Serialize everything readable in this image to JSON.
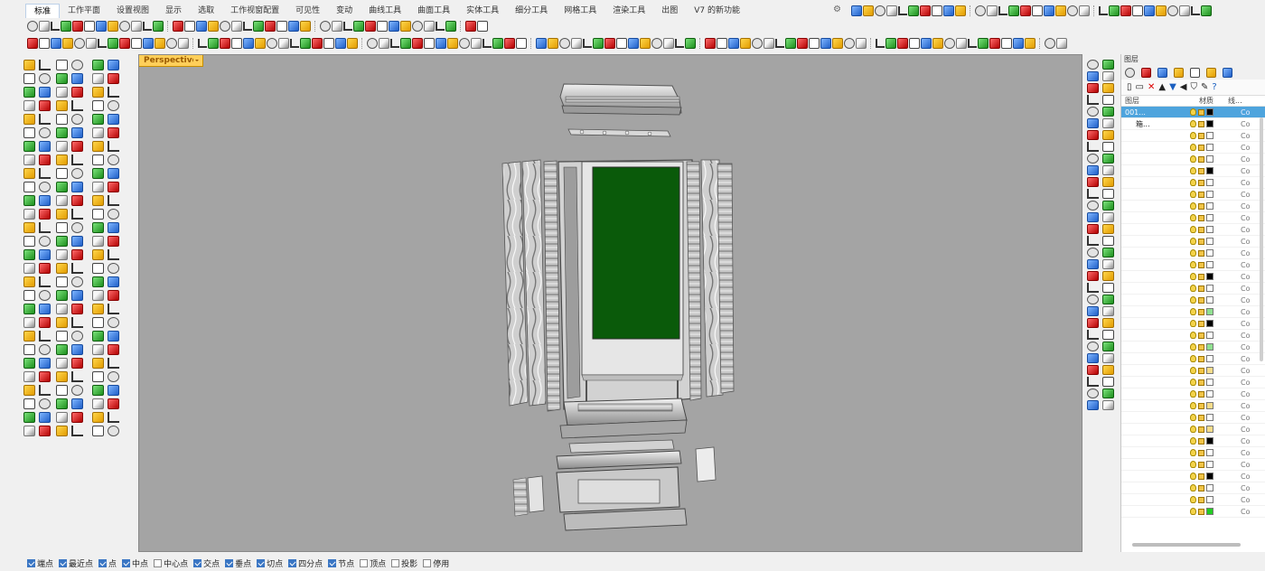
{
  "tabs": [
    "标准",
    "工作平面",
    "设置视图",
    "显示",
    "选取",
    "工作视窗配置",
    "可见性",
    "变动",
    "曲线工具",
    "曲面工具",
    "实体工具",
    "细分工具",
    "网格工具",
    "渲染工具",
    "出图",
    "V7 的新功能"
  ],
  "active_tab_index": 0,
  "viewport": {
    "title": "Perspective",
    "background": "#a4a4a4",
    "screen_color": "#0a5a0a"
  },
  "layers_panel": {
    "title": "图层",
    "headers": {
      "name": "图层",
      "material": "材质",
      "linetype": "线..."
    },
    "rows": [
      {
        "name": "001...",
        "color": "#000000",
        "line": "Co",
        "selected": true
      },
      {
        "name": "箱...",
        "color": "#000000",
        "line": "Co"
      },
      {
        "name": "",
        "color": "#ffffff",
        "line": "Co"
      },
      {
        "name": "",
        "color": "#ffffff",
        "line": "Co"
      },
      {
        "name": "",
        "color": "#ffffff",
        "line": "Co"
      },
      {
        "name": "",
        "color": "#000000",
        "line": "Co"
      },
      {
        "name": "",
        "color": "#ffffff",
        "line": "Co"
      },
      {
        "name": "",
        "color": "#ffffff",
        "line": "Co"
      },
      {
        "name": "",
        "color": "#ffffff",
        "line": "Co"
      },
      {
        "name": "",
        "color": "#ffffff",
        "line": "Co"
      },
      {
        "name": "",
        "color": "#ffffff",
        "line": "Co"
      },
      {
        "name": "",
        "color": "#ffffff",
        "line": "Co"
      },
      {
        "name": "",
        "color": "#ffffff",
        "line": "Co"
      },
      {
        "name": "",
        "color": "#ffffff",
        "line": "Co"
      },
      {
        "name": "",
        "color": "#000000",
        "line": "Co"
      },
      {
        "name": "",
        "color": "#ffffff",
        "line": "Co"
      },
      {
        "name": "",
        "color": "#ffffff",
        "line": "Co"
      },
      {
        "name": "",
        "color": "#90e090",
        "line": "Co"
      },
      {
        "name": "",
        "color": "#000000",
        "line": "Co"
      },
      {
        "name": "",
        "color": "#ffffff",
        "line": "Co"
      },
      {
        "name": "",
        "color": "#90e090",
        "line": "Co"
      },
      {
        "name": "",
        "color": "#ffffff",
        "line": "Co"
      },
      {
        "name": "",
        "color": "#f5dc8a",
        "line": "Co"
      },
      {
        "name": "",
        "color": "#ffffff",
        "line": "Co"
      },
      {
        "name": "",
        "color": "#ffffff",
        "line": "Co"
      },
      {
        "name": "",
        "color": "#f5dc8a",
        "line": "Co"
      },
      {
        "name": "",
        "color": "#ffffff",
        "line": "Co"
      },
      {
        "name": "",
        "color": "#f5dc8a",
        "line": "Co"
      },
      {
        "name": "",
        "color": "#000000",
        "line": "Co"
      },
      {
        "name": "",
        "color": "#ffffff",
        "line": "Co"
      },
      {
        "name": "",
        "color": "#ffffff",
        "line": "Co"
      },
      {
        "name": "",
        "color": "#000000",
        "line": "Co"
      },
      {
        "name": "",
        "color": "#ffffff",
        "line": "Co"
      },
      {
        "name": "",
        "color": "#ffffff",
        "line": "Co"
      },
      {
        "name": "",
        "color": "#22cc22",
        "line": "Co"
      }
    ]
  },
  "status_snaps": [
    {
      "label": "端点",
      "checked": true
    },
    {
      "label": "最近点",
      "checked": true
    },
    {
      "label": "点",
      "checked": true
    },
    {
      "label": "中点",
      "checked": true
    },
    {
      "label": "中心点",
      "checked": false
    },
    {
      "label": "交点",
      "checked": true
    },
    {
      "label": "垂点",
      "checked": true
    },
    {
      "label": "切点",
      "checked": true
    },
    {
      "label": "四分点",
      "checked": true
    },
    {
      "label": "节点",
      "checked": true
    },
    {
      "label": "顶点",
      "checked": false
    },
    {
      "label": "投影",
      "checked": false
    },
    {
      "label": "停用",
      "checked": false
    }
  ],
  "colors": {
    "accent": "#4ea4dd",
    "viewport_label": "#ffcf5a",
    "checkbox": "#3a76c4"
  }
}
